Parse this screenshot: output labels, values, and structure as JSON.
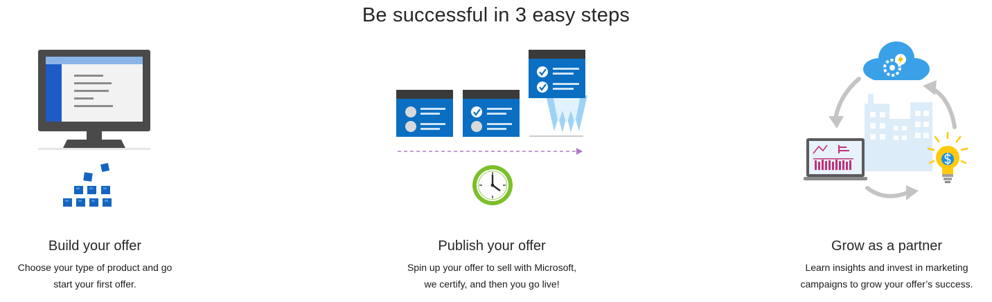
{
  "page": {
    "title": "Be successful in 3 easy steps"
  },
  "steps": [
    {
      "heading": "Build your offer",
      "description_lines": [
        "Choose your type of product and go",
        "start your first offer."
      ],
      "illustration": "monitor-with-blocks-icon"
    },
    {
      "heading": "Publish your offer",
      "description_lines": [
        "Spin up your offer to sell with Microsoft,",
        "we certify, and then you go live!"
      ],
      "illustration": "publish-cards-clock-icon"
    },
    {
      "heading": "Grow as a partner",
      "description_lines": [
        "Learn insights and invest in marketing",
        "campaigns to grow your offer’s success."
      ],
      "illustration": "cloud-city-growth-icon"
    }
  ],
  "colors": {
    "azure_blue": "#0078d4",
    "dark_blue": "#1a5aa0",
    "monitor_gray": "#4a4a4a",
    "clock_green": "#7cbf2a",
    "dashed_purple": "#b07ac4",
    "bulb_yellow": "#ffc90e",
    "arrow_gray": "#bdbdbd",
    "chart_magenta": "#c2307a"
  }
}
